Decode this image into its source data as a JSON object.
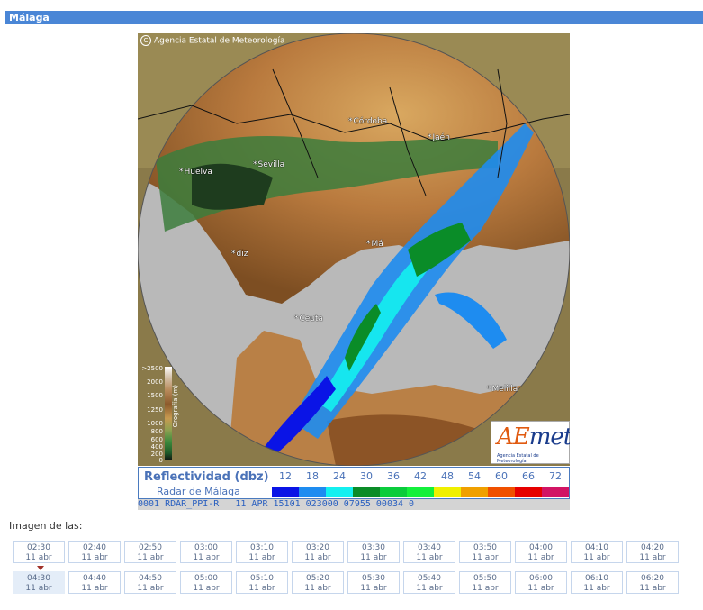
{
  "title": "Málaga",
  "map": {
    "copyright": "Agencia Estatal de Meteorología",
    "cities": [
      "Córdoba",
      "Jaén",
      "Sevilla",
      "Huelva",
      "Ceuta",
      "Melilla",
      "Má",
      "diz"
    ],
    "orography": {
      "labels": [
        ">2500",
        "2000",
        "1500",
        "1250",
        "1000",
        "800",
        "600",
        "400",
        "200",
        "0"
      ],
      "axis_label": "Orografía (m)"
    },
    "logo": {
      "main": "AEmet",
      "sub": "Agencia Estatal de Meteorología"
    }
  },
  "legend": {
    "title": "Reflectividad (dbz)",
    "subtitle": "Radar de Málaga",
    "values": [
      "12",
      "18",
      "24",
      "30",
      "36",
      "42",
      "48",
      "54",
      "60",
      "66",
      "72"
    ],
    "colors": [
      "#0a14e6",
      "#1e8cf0",
      "#14f0f0",
      "#0a8c28",
      "#0acc3c",
      "#14f03c",
      "#f0f000",
      "#f0a000",
      "#f05000",
      "#e60000",
      "#d21464"
    ]
  },
  "status": "0001 RDAR_PPI-R   11 APR 15101 023000 07955 00034 0",
  "image_label": "Imagen de las:",
  "times": [
    [
      {
        "time": "02:30",
        "date": "11 abr"
      },
      {
        "time": "02:40",
        "date": "11 abr"
      },
      {
        "time": "02:50",
        "date": "11 abr"
      },
      {
        "time": "03:00",
        "date": "11 abr"
      },
      {
        "time": "03:10",
        "date": "11 abr"
      },
      {
        "time": "03:20",
        "date": "11 abr"
      },
      {
        "time": "03:30",
        "date": "11 abr"
      },
      {
        "time": "03:40",
        "date": "11 abr"
      },
      {
        "time": "03:50",
        "date": "11 abr"
      },
      {
        "time": "04:00",
        "date": "11 abr"
      },
      {
        "time": "04:10",
        "date": "11 abr"
      },
      {
        "time": "04:20",
        "date": "11 abr"
      }
    ],
    [
      {
        "time": "04:30",
        "date": "11 abr",
        "selected": true
      },
      {
        "time": "04:40",
        "date": "11 abr"
      },
      {
        "time": "04:50",
        "date": "11 abr"
      },
      {
        "time": "05:00",
        "date": "11 abr"
      },
      {
        "time": "05:10",
        "date": "11 abr"
      },
      {
        "time": "05:20",
        "date": "11 abr"
      },
      {
        "time": "05:30",
        "date": "11 abr"
      },
      {
        "time": "05:40",
        "date": "11 abr"
      },
      {
        "time": "05:50",
        "date": "11 abr"
      },
      {
        "time": "06:00",
        "date": "11 abr"
      },
      {
        "time": "06:10",
        "date": "11 abr"
      },
      {
        "time": "06:20",
        "date": "11 abr"
      }
    ]
  ]
}
